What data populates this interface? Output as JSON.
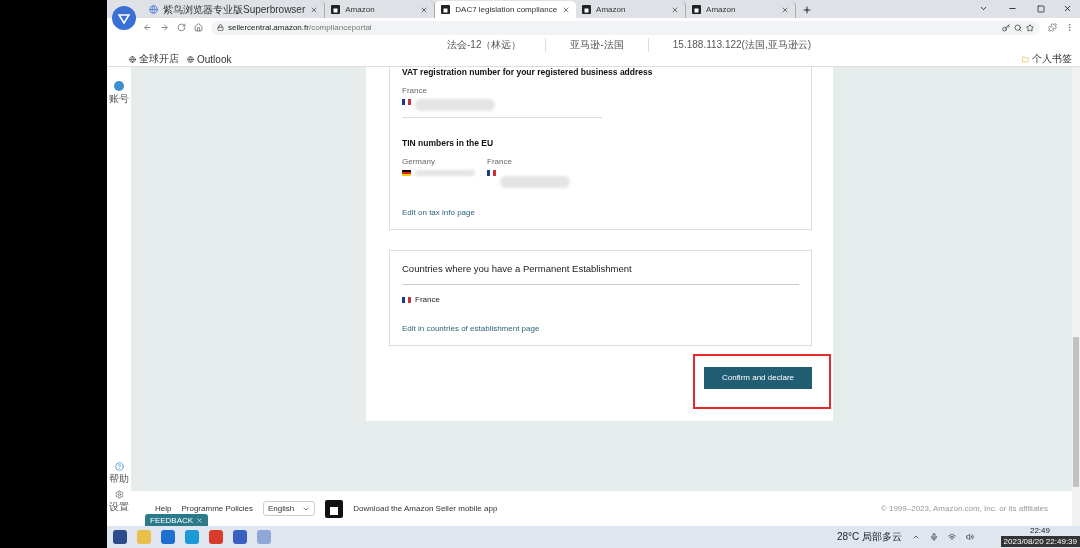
{
  "browser": {
    "tabs": [
      {
        "title": "紫鸟浏览器专业版Superbrowser",
        "kind": "globe",
        "selected": false
      },
      {
        "title": "Amazon",
        "kind": "shop",
        "selected": false
      },
      {
        "title": "DAC7 legislation compliance",
        "kind": "shop",
        "selected": true
      },
      {
        "title": "Amazon",
        "kind": "shop",
        "selected": false
      },
      {
        "title": "Amazon",
        "kind": "shop",
        "selected": false
      }
    ],
    "address": {
      "host": "sellercentral.amazon.fr",
      "path": "/complianceportal"
    },
    "info_bar": [
      "法会-12（林远）",
      "亚马逊-法国",
      "15.188.113.122(法国,亚马逊云)"
    ],
    "bookmarks": [
      "全球开店",
      "Outlook"
    ],
    "personal_bookmarks": "个人书签"
  },
  "side_rail": {
    "top": [
      {
        "label": "账号"
      }
    ],
    "bottom": [
      {
        "label": "帮助",
        "kind": "help"
      },
      {
        "label": "设置",
        "kind": "settings"
      }
    ]
  },
  "card": {
    "vat": {
      "title": "VAT registration number for your registered business address",
      "country": "France",
      "kind": "france"
    },
    "tin": {
      "title": "TIN numbers in the EU",
      "entries": [
        {
          "country": "Germany",
          "kind": "germany"
        },
        {
          "country": "France",
          "kind": "france"
        }
      ],
      "link": "Edit on tax info page"
    },
    "establishment": {
      "title": "Countries where you have a Permanent Establishment",
      "countries": [
        {
          "name": "France",
          "kind": "france"
        }
      ],
      "link": "Edit in countries of establishment page"
    },
    "confirm": {
      "label": "Confirm and declare",
      "highlighted": true
    }
  },
  "footer": {
    "links": [
      "Help",
      "Programme Policies"
    ],
    "language": "English",
    "app_promo": "Download the Amazon Seller mobile app",
    "copyright": "© 1999–2023, Amazon.com, Inc. or its affiliates"
  },
  "feedback": "FEEDBACK",
  "taskbar": {
    "weather": "28°C 局部多云",
    "time": "22:49",
    "tooltip": "2023/08/20 22:49:39"
  }
}
